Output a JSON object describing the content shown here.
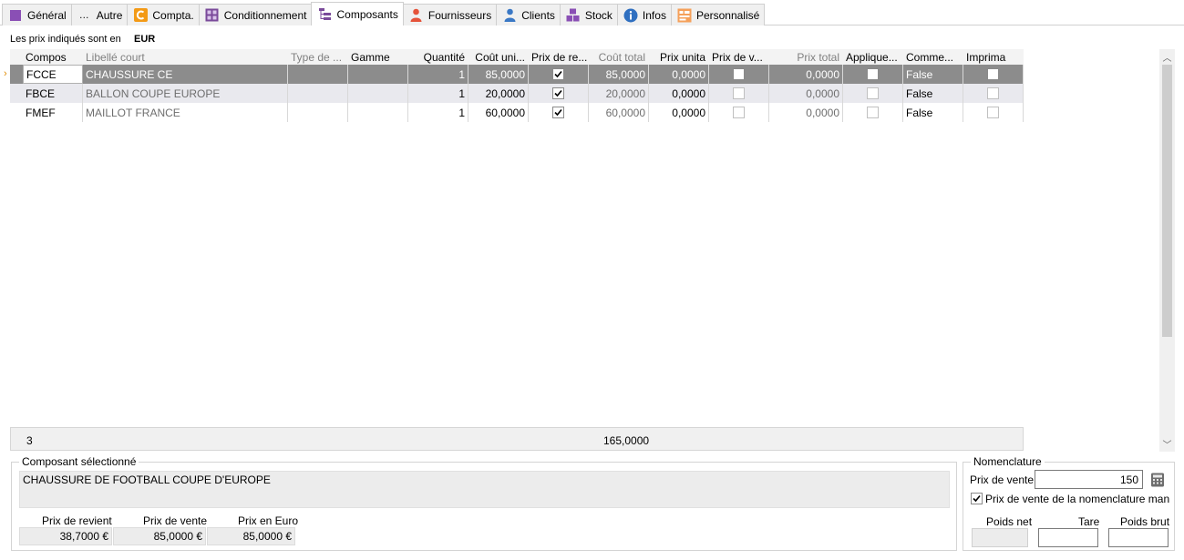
{
  "tabs": [
    {
      "label": "Général",
      "icon": "general-icon"
    },
    {
      "label": "Autre",
      "icon": "dots-icon"
    },
    {
      "label": "Compta.",
      "icon": "compta-icon"
    },
    {
      "label": "Conditionnement",
      "icon": "grid-icon"
    },
    {
      "label": "Composants",
      "icon": "tree-icon",
      "active": true
    },
    {
      "label": "Fournisseurs",
      "icon": "person-red-icon"
    },
    {
      "label": "Clients",
      "icon": "person-blue-icon"
    },
    {
      "label": "Stock",
      "icon": "boxes-icon"
    },
    {
      "label": "Infos",
      "icon": "info-icon"
    },
    {
      "label": "Personnalisé",
      "icon": "custom-icon"
    }
  ],
  "prices": {
    "label": "Les prix indiqués sont en",
    "currency": "EUR"
  },
  "grid": {
    "headers": [
      "Compos",
      "Libellé court",
      "Type de ...",
      "Gamme",
      "Quantité",
      "Coût uni...",
      "Prix de re...",
      "Coût total",
      "Prix unita",
      "Prix de v...",
      "Prix total",
      "Applique...",
      "Comme...",
      "Imprima"
    ],
    "rows": [
      {
        "code": "FCCE",
        "label": "CHAUSSURE CE",
        "type": "",
        "gamme": "",
        "qty": "1",
        "cost_unit": "85,0000",
        "prix_revient": true,
        "cost_total": "85,0000",
        "prix_unit": "0,0000",
        "prix_vente": false,
        "prix_total": "0,0000",
        "applique": false,
        "comment": "False",
        "imprime": false
      },
      {
        "code": "FBCE",
        "label": "BALLON COUPE EUROPE",
        "type": "",
        "gamme": "",
        "qty": "1",
        "cost_unit": "20,0000",
        "prix_revient": true,
        "cost_total": "20,0000",
        "prix_unit": "0,0000",
        "prix_vente": false,
        "prix_total": "0,0000",
        "applique": false,
        "comment": "False",
        "imprime": false
      },
      {
        "code": "FMEF",
        "label": "MAILLOT FRANCE",
        "type": "",
        "gamme": "",
        "qty": "1",
        "cost_unit": "60,0000",
        "prix_revient": true,
        "cost_total": "60,0000",
        "prix_unit": "0,0000",
        "prix_vente": false,
        "prix_total": "0,0000",
        "applique": false,
        "comment": "False",
        "imprime": false
      }
    ],
    "footer": {
      "count": "3",
      "total": "165,0000"
    }
  },
  "selected": {
    "title": "Composant sélectionné",
    "description": "CHAUSSURE DE FOOTBALL COUPE D'EUROPE",
    "prix_revient_label": "Prix de revient",
    "prix_revient": "38,7000 €",
    "prix_vente_label": "Prix de vente",
    "prix_vente": "85,0000 €",
    "prix_euro_label": "Prix en Euro",
    "prix_euro": "85,0000 €"
  },
  "nomenclature": {
    "title": "Nomenclature",
    "prix_vente_label": "Prix de vente",
    "prix_vente": "150",
    "man_label": "Prix de vente de la nomenclature man",
    "man_checked": true,
    "poids_net_label": "Poids net",
    "tare_label": "Tare",
    "poids_brut_label": "Poids brut"
  }
}
